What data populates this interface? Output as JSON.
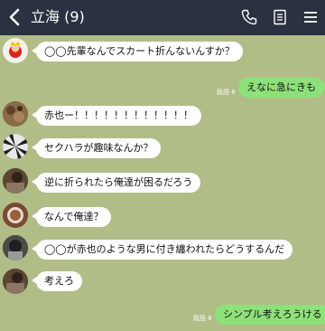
{
  "header": {
    "title": "立海 (9)",
    "icons": [
      "back-icon",
      "phone-icon",
      "notes-icon",
      "menu-icon"
    ]
  },
  "messages": [
    {
      "side": "left",
      "text": "◯◯先輩なんでスカート折んないんすか？",
      "avatar": "avatar-1"
    },
    {
      "side": "right",
      "text": "えなに急にきも",
      "read": "既読 8"
    },
    {
      "side": "left",
      "text": "赤也ー！！！！！！！！！！！！",
      "avatar": "avatar-2"
    },
    {
      "side": "left",
      "text": "セクハラが趣味なんか？",
      "avatar": "avatar-3"
    },
    {
      "side": "left",
      "text": "逆に折られたら俺達が困るだろう",
      "avatar": "avatar-4"
    },
    {
      "side": "left",
      "text": "なんで俺達？",
      "avatar": "avatar-5"
    },
    {
      "side": "left",
      "text": "◯◯が赤也のような男に付き纏われたらどうするんだ",
      "avatar": "avatar-6"
    },
    {
      "side": "left",
      "text": "考えろ",
      "avatar": "avatar-7"
    },
    {
      "side": "right",
      "text": "シンプル考えろうける",
      "read": "既読 8"
    }
  ],
  "colors": {
    "background": "#b0bd87",
    "header": "#2a3140",
    "bubble_left": "#ffffff",
    "bubble_right": "#8ee17a"
  }
}
